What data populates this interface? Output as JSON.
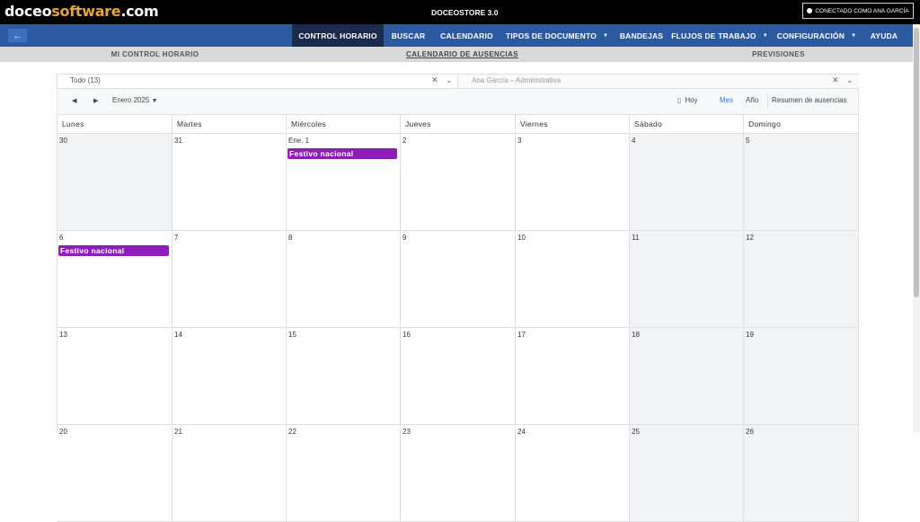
{
  "header": {
    "logo_part1": "doceo",
    "logo_part2": "software",
    "logo_part3": ".com",
    "app_title": "DOCEOSTORE 3.0",
    "user_label": "CONECTADO COMO ANA GARCÍA"
  },
  "nav": {
    "items": [
      {
        "label": "CONTROL HORARIO",
        "active": true,
        "dropdown": false
      },
      {
        "label": "BUSCAR",
        "active": false,
        "dropdown": false
      },
      {
        "label": "CALENDARIO",
        "active": false,
        "dropdown": false
      },
      {
        "label": "TIPOS DE DOCUMENTO",
        "active": false,
        "dropdown": true
      },
      {
        "label": "BANDEJAS",
        "active": false,
        "dropdown": false
      },
      {
        "label": "FLUJOS DE TRABAJO",
        "active": false,
        "dropdown": true
      },
      {
        "label": "CONFIGURACIÓN",
        "active": false,
        "dropdown": true
      },
      {
        "label": "AYUDA",
        "active": false,
        "dropdown": false
      }
    ]
  },
  "subnav": {
    "items": [
      {
        "label": "MI CONTROL HORARIO",
        "active": false
      },
      {
        "label": "CALENDARIO DE AUSENCIAS",
        "active": true
      },
      {
        "label": "PREVISIONES",
        "active": false
      }
    ]
  },
  "filters": {
    "group_value": "Todo (13)",
    "person_placeholder": "Ana García – Administrativa"
  },
  "toolbar": {
    "month_label": "Enero 2025",
    "today_label": "Hoy",
    "month_view": "Mes",
    "year_view": "Año",
    "summary_label": "Resumen de ausencias"
  },
  "calendar": {
    "weekdays": [
      "Lunes",
      "Martes",
      "Miércoles",
      "Jueves",
      "Viernes",
      "Sábado",
      "Domingo"
    ],
    "weeks": [
      [
        {
          "day": "30",
          "other": true
        },
        {
          "day": "31"
        },
        {
          "day": "Ene. 1",
          "event": "Festivo nacional"
        },
        {
          "day": "2"
        },
        {
          "day": "3"
        },
        {
          "day": "4"
        },
        {
          "day": "5"
        }
      ],
      [
        {
          "day": "6",
          "event": "Festivo nacional"
        },
        {
          "day": "7"
        },
        {
          "day": "8"
        },
        {
          "day": "9"
        },
        {
          "day": "10"
        },
        {
          "day": "11"
        },
        {
          "day": "12"
        }
      ],
      [
        {
          "day": "13"
        },
        {
          "day": "14"
        },
        {
          "day": "15"
        },
        {
          "day": "16"
        },
        {
          "day": "17"
        },
        {
          "day": "18"
        },
        {
          "day": "19"
        }
      ],
      [
        {
          "day": "20"
        },
        {
          "day": "21"
        },
        {
          "day": "22"
        },
        {
          "day": "23"
        },
        {
          "day": "24"
        },
        {
          "day": "25"
        },
        {
          "day": "26"
        }
      ]
    ]
  },
  "colors": {
    "nav_bg": "#2c5aa0",
    "nav_active": "#1b2b4e",
    "event": "#8e1cb8",
    "accent_link": "#2f7ad8"
  }
}
